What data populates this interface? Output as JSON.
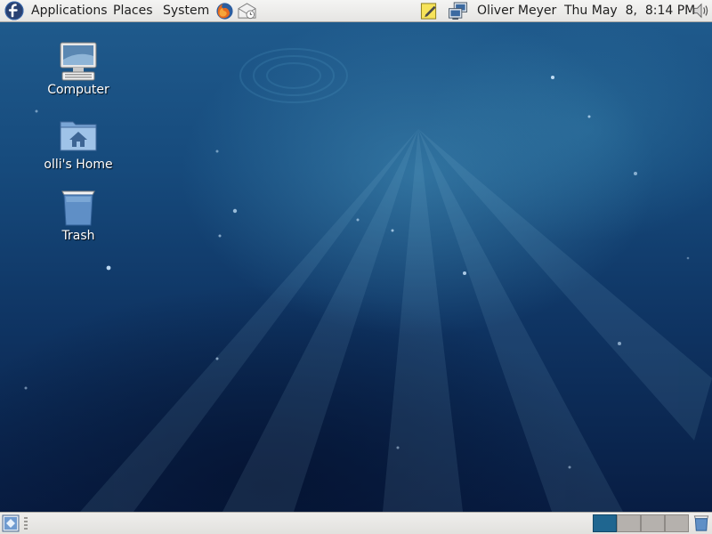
{
  "top_panel": {
    "menus": {
      "applications": "Applications",
      "places": "Places",
      "system": "System"
    },
    "launchers": [
      "firefox-icon",
      "mail-icon"
    ],
    "tray": [
      "notes-icon",
      "network-icon",
      "volume-icon"
    ],
    "user_name": "Oliver Meyer",
    "clock": "Thu May  8,  8:14 PM"
  },
  "desktop": {
    "icons": [
      {
        "label": "Computer",
        "icon": "computer-icon"
      },
      {
        "label": "olli's Home",
        "icon": "home-folder-icon"
      },
      {
        "label": "Trash",
        "icon": "trash-icon"
      }
    ]
  },
  "bottom_panel": {
    "workspaces": {
      "count": 4,
      "active": 1
    },
    "show_desktop_icon": "show-desktop-icon",
    "trash_applet_icon": "trash-applet-icon"
  },
  "colors": {
    "panel": "#e6e5e3",
    "workspace_active": "#1f6690",
    "workspace_inactive": "#b5b1ad",
    "desktop_base": "#0f3564"
  }
}
